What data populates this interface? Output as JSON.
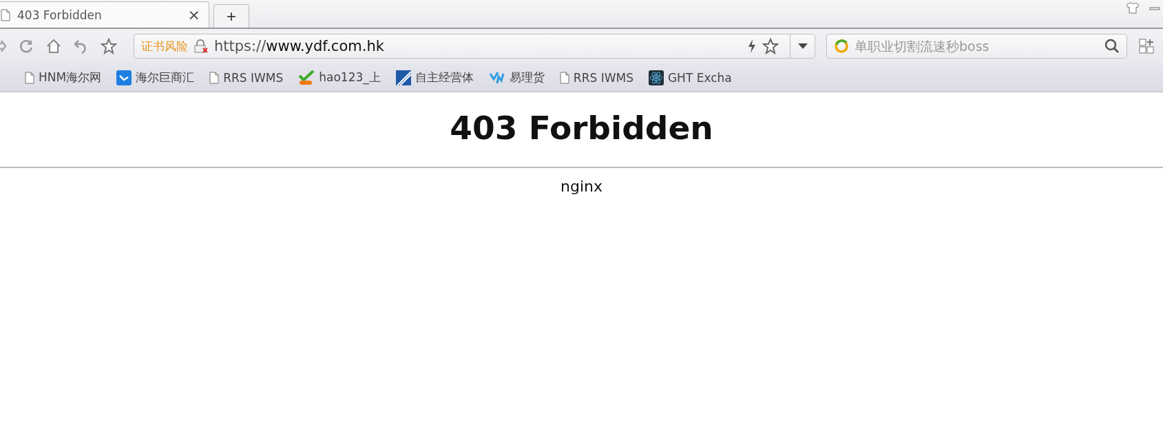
{
  "tabs": [
    {
      "label": "403 Forbidden",
      "selected": true,
      "close": "×"
    }
  ],
  "new_tab": "+",
  "address_bar": {
    "security_warning": "证书风险",
    "scheme": "https://",
    "host": "www.ydf.com.hk"
  },
  "search": {
    "placeholder": "单职业切割流速秒boss"
  },
  "bookmarks": [
    {
      "label": "HNM海尔网",
      "kind": "page"
    },
    {
      "label": "海尔巨商汇",
      "kind": "blue"
    },
    {
      "label": "RRS IWMS",
      "kind": "page"
    },
    {
      "label": "hao123_上",
      "kind": "hao"
    },
    {
      "label": "自主经营体",
      "kind": "stripe"
    },
    {
      "label": "易理货",
      "kind": "yh"
    },
    {
      "label": "RRS IWMS",
      "kind": "page"
    },
    {
      "label": "GHT Excha",
      "kind": "atom"
    }
  ],
  "page": {
    "heading": "403 Forbidden",
    "server": "nginx"
  }
}
